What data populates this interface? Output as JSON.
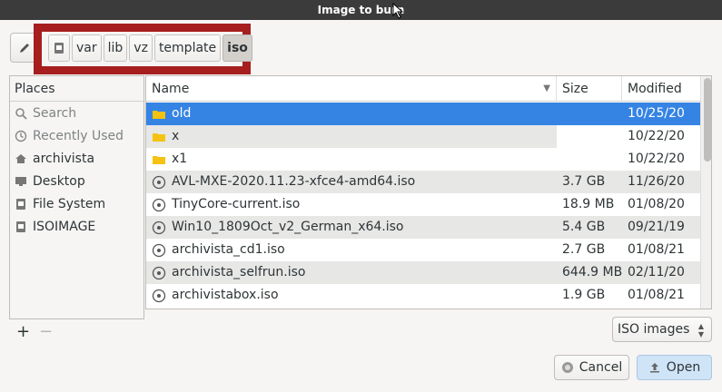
{
  "window": {
    "title": "Image to burn"
  },
  "pathbar": {
    "crumbs": [
      "var",
      "lib",
      "vz",
      "template",
      "iso"
    ],
    "active": "iso"
  },
  "places": {
    "header": "Places",
    "items": [
      {
        "label": "Search",
        "icon": "search-icon"
      },
      {
        "label": "Recently Used",
        "icon": "clock-icon"
      },
      {
        "label": "archivista",
        "icon": "home-icon"
      },
      {
        "label": "Desktop",
        "icon": "desktop-icon"
      },
      {
        "label": "File System",
        "icon": "drive-icon"
      },
      {
        "label": "ISOIMAGE",
        "icon": "drive-icon"
      }
    ]
  },
  "files": {
    "columns": {
      "name": "Name",
      "size": "Size",
      "modified": "Modified"
    },
    "rows": [
      {
        "name": "old",
        "size": "",
        "modified": "10/25/20",
        "type": "folder"
      },
      {
        "name": "x",
        "size": "",
        "modified": "10/22/20",
        "type": "folder"
      },
      {
        "name": "x1",
        "size": "",
        "modified": "10/22/20",
        "type": "folder"
      },
      {
        "name": "AVL-MXE-2020.11.23-xfce4-amd64.iso",
        "size": "3.7 GB",
        "modified": "11/26/20",
        "type": "iso"
      },
      {
        "name": "TinyCore-current.iso",
        "size": "18.9 MB",
        "modified": "01/08/20",
        "type": "iso"
      },
      {
        "name": "Win10_1809Oct_v2_German_x64.iso",
        "size": "5.4 GB",
        "modified": "09/21/19",
        "type": "iso"
      },
      {
        "name": "archivista_cd1.iso",
        "size": "2.7 GB",
        "modified": "01/08/21",
        "type": "iso"
      },
      {
        "name": "archivista_selfrun.iso",
        "size": "644.9 MB",
        "modified": "02/11/20",
        "type": "iso"
      },
      {
        "name": "archivistabox.iso",
        "size": "1.9 GB",
        "modified": "01/08/21",
        "type": "iso"
      }
    ]
  },
  "filter": {
    "selected": "ISO images"
  },
  "buttons": {
    "cancel": "Cancel",
    "open": "Open",
    "add": "+",
    "remove": "−"
  },
  "colors": {
    "selection": "#3584e4",
    "highlight_border": "#a61e1e",
    "folder": "#f5c211",
    "titlebar": "#3b3b3b"
  }
}
